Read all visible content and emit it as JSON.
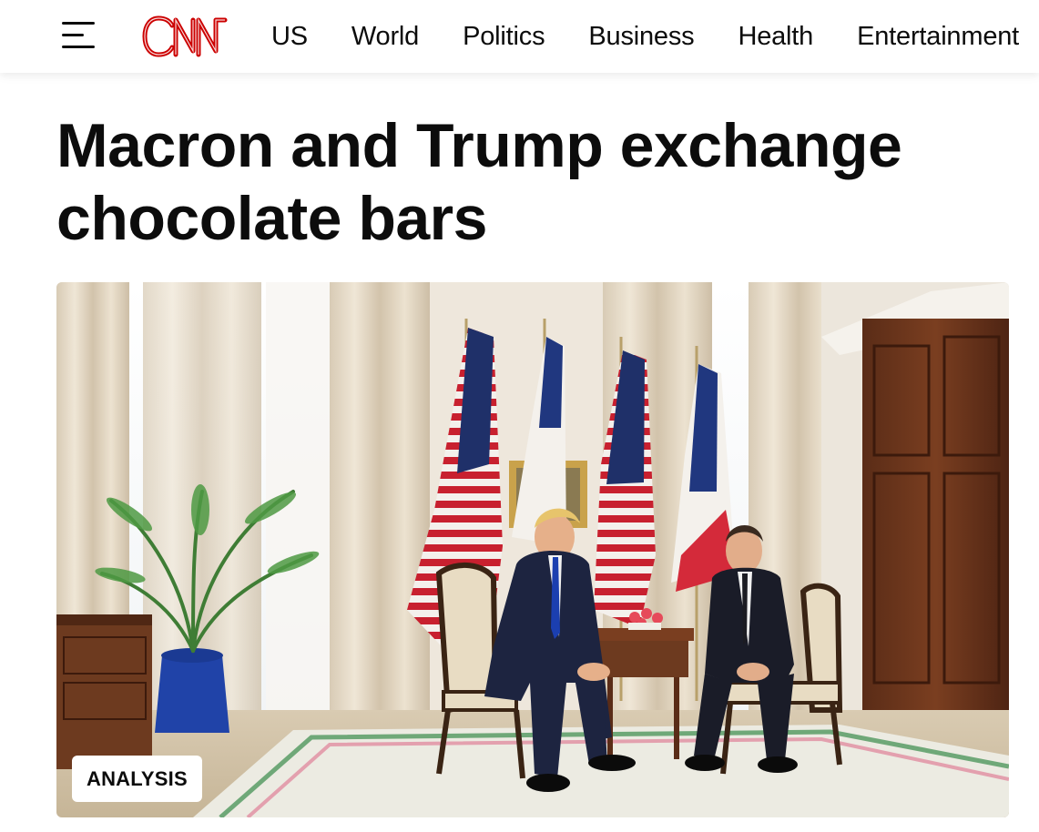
{
  "nav": {
    "logo_text": "CNN",
    "links": [
      {
        "label": "US"
      },
      {
        "label": "World"
      },
      {
        "label": "Politics"
      },
      {
        "label": "Business"
      },
      {
        "label": "Health"
      },
      {
        "label": "Entertainment"
      }
    ]
  },
  "article": {
    "headline": "Macron and Trump exchange chocolate bars",
    "badge": "ANALYSIS"
  },
  "icons": {
    "menu": "hamburger-menu-icon",
    "logo": "cnn-logo"
  },
  "colors": {
    "brand_red": "#cc0000",
    "text": "#0c0c0c",
    "background": "#ffffff"
  }
}
